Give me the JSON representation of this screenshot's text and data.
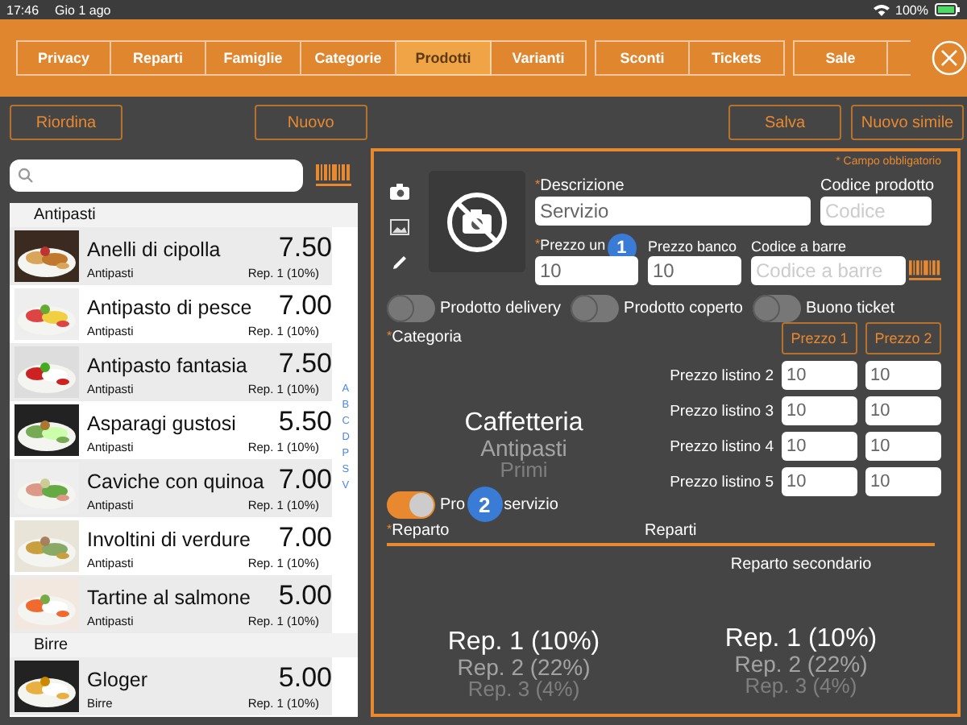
{
  "status_bar": {
    "time": "17:46",
    "date": "Gio 1 ago",
    "battery": "100%"
  },
  "tab_groups": [
    [
      {
        "label": "Privacy",
        "selected": false
      },
      {
        "label": "Reparti",
        "selected": false
      },
      {
        "label": "Famiglie",
        "selected": false
      },
      {
        "label": "Categorie",
        "selected": false
      },
      {
        "label": "Prodotti",
        "selected": true
      },
      {
        "label": "Varianti",
        "selected": false
      }
    ],
    [
      {
        "label": "Sconti",
        "selected": false
      },
      {
        "label": "Tickets",
        "selected": false
      }
    ],
    [
      {
        "label": "Sale",
        "selected": false
      },
      {
        "selected": false
      }
    ]
  ],
  "toolbar": {
    "left": [
      "Riordina"
    ],
    "center": [
      "Nuovo"
    ],
    "right": [
      "Salva",
      "Nuovo simile"
    ]
  },
  "list": {
    "sections": [
      {
        "title": "Antipasti",
        "items": [
          {
            "name": "Anelli di cipolla",
            "price": "7.50",
            "category": "Antipasti",
            "department": "Rep. 1 (10%)"
          },
          {
            "name": "Antipasto di pesce",
            "price": "7.00",
            "category": "Antipasti",
            "department": "Rep. 1 (10%)"
          },
          {
            "name": "Antipasto fantasia",
            "price": "7.50",
            "category": "Antipasti",
            "department": "Rep. 1 (10%)"
          },
          {
            "name": "Asparagi gustosi",
            "price": "5.50",
            "category": "Antipasti",
            "department": "Rep. 1 (10%)"
          },
          {
            "name": "Caviche con quinoa",
            "price": "7.00",
            "category": "Antipasti",
            "department": "Rep. 1 (10%)"
          },
          {
            "name": "Involtini di verdure",
            "price": "7.00",
            "category": "Antipasti",
            "department": "Rep. 1 (10%)"
          },
          {
            "name": "Tartine al salmone",
            "price": "5.00",
            "category": "Antipasti",
            "department": "Rep. 1 (10%)"
          }
        ]
      },
      {
        "title": "Birre",
        "items": [
          {
            "name": "Gloger",
            "price": "5.00",
            "category": "Birre",
            "department": "Rep. 1 (10%)"
          }
        ]
      }
    ],
    "index": [
      "A",
      "B",
      "C",
      "D",
      "P",
      "S",
      "V"
    ]
  },
  "form": {
    "required_note": "* Campo obbligatorio",
    "description": {
      "mark": "*",
      "label": "Descrizione",
      "value": "Servizio"
    },
    "code": {
      "label": "Codice prodotto",
      "placeholder": "Codice"
    },
    "unit_price": {
      "mark": "*",
      "label": "Prezzo un",
      "badge": "1",
      "value": "10"
    },
    "counter_price": {
      "label": "Prezzo banco",
      "value": "10"
    },
    "barcode": {
      "label": "Codice a barre",
      "placeholder": "Codice a barre"
    },
    "toggles": [
      {
        "label": "Prodotto delivery",
        "on": false
      },
      {
        "label": "Prodotto coperto",
        "on": false
      },
      {
        "label": "Buono ticket",
        "on": false
      }
    ],
    "category": {
      "mark": "*",
      "label": "Categoria",
      "items": [
        {
          "text": "Caffetteria",
          "selected": true
        },
        {
          "text": "Antipasti",
          "selected": false
        },
        {
          "text": "Primi",
          "selected": false
        }
      ]
    },
    "price_columns": [
      "Prezzo 1",
      "Prezzo 2"
    ],
    "price_lists": [
      {
        "label": "Prezzo listino 2",
        "values": [
          "10",
          "10"
        ]
      },
      {
        "label": "Prezzo listino 3",
        "values": [
          "10",
          "10"
        ]
      },
      {
        "label": "Prezzo listino 4",
        "values": [
          "10",
          "10"
        ]
      },
      {
        "label": "Prezzo listino 5",
        "values": [
          "10",
          "10"
        ]
      }
    ],
    "service_toggle": {
      "label_before": "Pro",
      "badge": "2",
      "label_after": "servizio",
      "on": true
    },
    "department": {
      "mark": "*",
      "label": "Reparto",
      "header": "Reparti",
      "secondary_label": "Reparto secondario",
      "items": [
        {
          "text": "Rep. 1 (10%)",
          "selected": true
        },
        {
          "text": "Rep. 2 (22%)",
          "selected": false
        },
        {
          "text": "Rep. 3 (4%)",
          "selected": false
        }
      ],
      "secondary_items": [
        {
          "text": "Rep. 1 (10%)",
          "selected": true
        },
        {
          "text": "Rep. 2 (22%)",
          "selected": false
        },
        {
          "text": "Rep. 3 (4%)",
          "selected": false
        }
      ]
    }
  }
}
